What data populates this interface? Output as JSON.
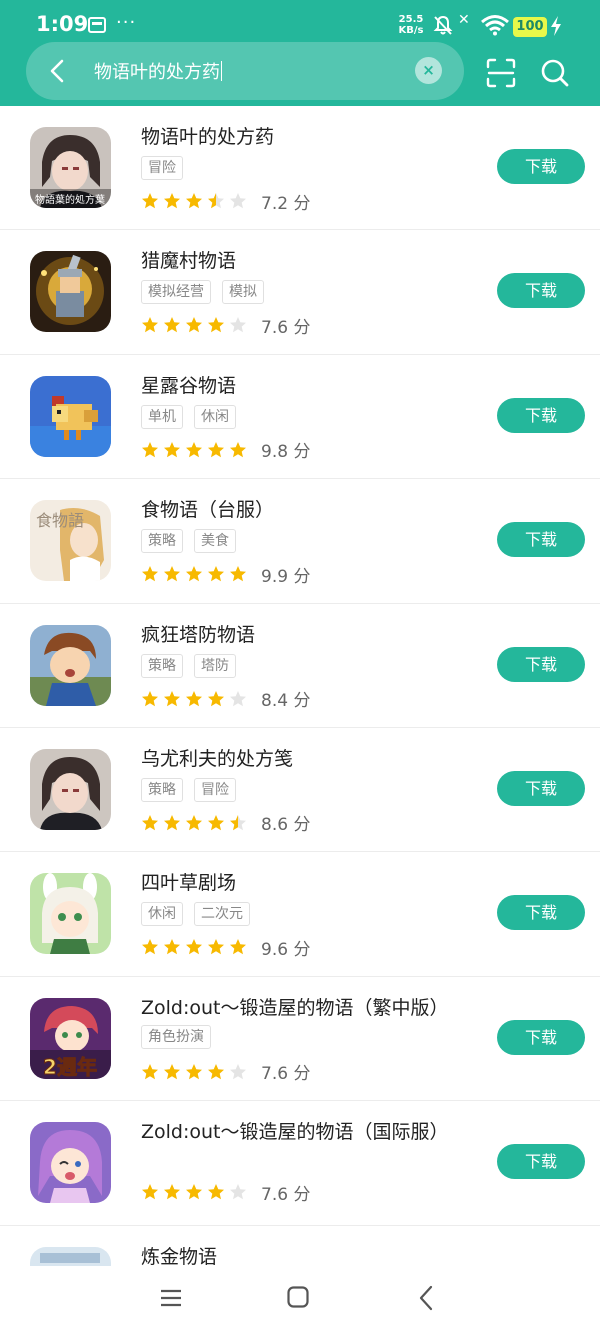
{
  "status_bar": {
    "time": "1:09",
    "dots": "···",
    "net_speed": "25.5",
    "net_unit": "KB/s",
    "battery": "100"
  },
  "search": {
    "query": "物语叶的处方药",
    "clear_label": "×"
  },
  "colors": {
    "accent": "#24b79b",
    "star_filled": "#f7b900",
    "star_empty": "#e4e4e4"
  },
  "download_label": "下载",
  "score_unit": "分",
  "results": [
    {
      "title": "物语叶的处方药",
      "tags": [
        "冒险"
      ],
      "rating": 3.5,
      "score": "7.2",
      "icon_text": "物語葉的処方葉"
    },
    {
      "title": "猎魔村物语",
      "tags": [
        "模拟经营",
        "模拟"
      ],
      "rating": 4,
      "score": "7.6"
    },
    {
      "title": "星露谷物语",
      "tags": [
        "单机",
        "休闲"
      ],
      "rating": 5,
      "score": "9.8"
    },
    {
      "title": "食物语（台服）",
      "tags": [
        "策略",
        "美食"
      ],
      "rating": 5,
      "score": "9.9",
      "icon_text": "食物語"
    },
    {
      "title": "疯狂塔防物语",
      "tags": [
        "策略",
        "塔防"
      ],
      "rating": 4,
      "score": "8.4"
    },
    {
      "title": "乌尤利夫的处方笺",
      "tags": [
        "策略",
        "冒险"
      ],
      "rating": 4.5,
      "score": "8.6"
    },
    {
      "title": "四叶草剧场",
      "tags": [
        "休闲",
        "二次元"
      ],
      "rating": 5,
      "score": "9.6"
    },
    {
      "title": "Zold:out～锻造屋的物语（繁中版）",
      "tags": [
        "角色扮演"
      ],
      "rating": 4,
      "score": "7.6",
      "icon_text": "2週年"
    },
    {
      "title": "Zold:out～锻造屋的物语（国际服）",
      "tags": [],
      "rating": 4,
      "score": "7.6"
    },
    {
      "title": "炼金物语",
      "tags": [],
      "rating": 0,
      "score": ""
    }
  ],
  "icons": {
    "back": "chevron-left-icon",
    "scan": "scan-icon",
    "search": "search-icon",
    "nav_menu": "menu-icon",
    "nav_home": "home-icon",
    "nav_back": "back-icon"
  }
}
